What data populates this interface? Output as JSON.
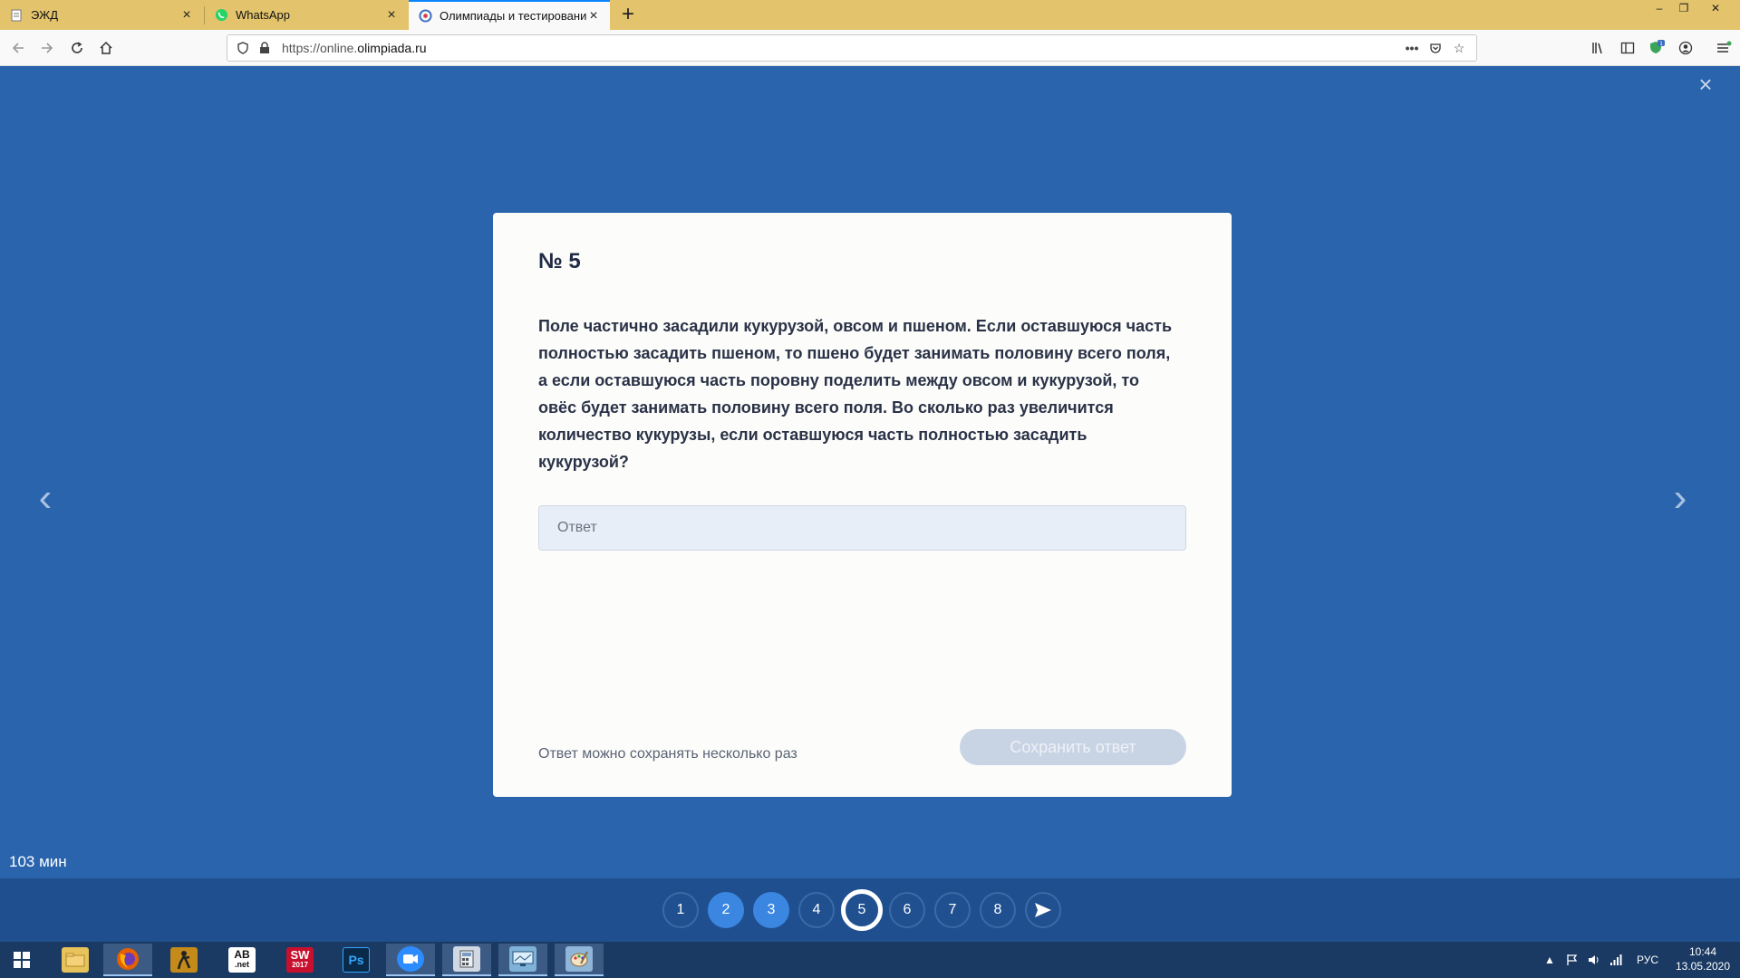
{
  "browser": {
    "tabs": [
      {
        "title": "ЭЖД",
        "active": false
      },
      {
        "title": "WhatsApp",
        "active": false
      },
      {
        "title": "Олимпиады и тестирования –",
        "active": true
      }
    ],
    "url_prefix": "https://online.",
    "url_domain": "olimpiada.ru"
  },
  "page": {
    "question_number": "№ 5",
    "question_text": "Поле частично засадили кукурузой, овсом и пшеном. Если оставшуюся часть полностью засадить пшеном, то пшено будет занимать половину всего поля, а если оставшуюся часть поровну поделить между овсом и кукурузой, то овёс будет занимать половину всего поля. Во сколько раз увеличится количество кукурузы, если оставшуюся часть полностью засадить кукурузой?",
    "answer_placeholder": "Ответ",
    "hint": "Ответ можно сохранять несколько раз",
    "save_button": "Сохранить ответ",
    "timer": "103 мин"
  },
  "navigator": {
    "questions": [
      {
        "label": "1",
        "state": "unanswered"
      },
      {
        "label": "2",
        "state": "answered"
      },
      {
        "label": "3",
        "state": "answered"
      },
      {
        "label": "4",
        "state": "unanswered"
      },
      {
        "label": "5",
        "state": "current"
      },
      {
        "label": "6",
        "state": "unanswered"
      },
      {
        "label": "7",
        "state": "unanswered"
      },
      {
        "label": "8",
        "state": "unanswered"
      }
    ],
    "send_icon": "send-arrow-icon"
  },
  "taskbar": {
    "language": "РУС",
    "time": "10:44",
    "date": "13.05.2020",
    "apps": [
      "file-explorer-icon",
      "firefox-icon",
      "game-icon",
      "abc-net-icon",
      "solidworks-icon",
      "photoshop-icon",
      "zoom-icon",
      "calculator-icon",
      "display-icon",
      "paint-icon"
    ],
    "app_labels": {
      "abc": "AB",
      "abc_sub": ".net",
      "sw": "SW",
      "sw_year": "2017",
      "ps": "Ps",
      "notif_count": "1"
    }
  },
  "colors": {
    "page_bg": "#2a64ad",
    "card_bg": "#fcfcfa",
    "answered": "#3a86e0",
    "tabbar": "#e3c46c"
  }
}
